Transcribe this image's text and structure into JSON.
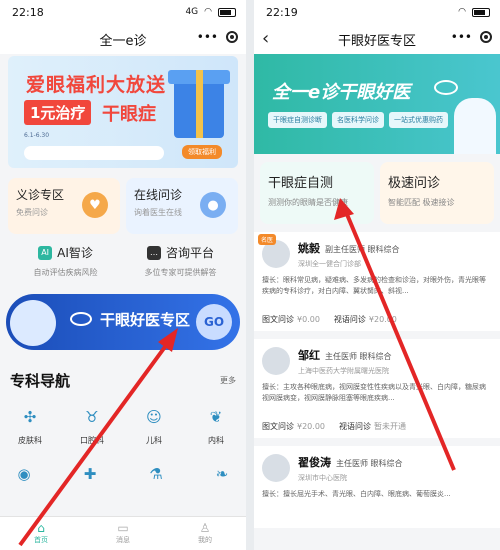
{
  "left": {
    "status": {
      "time": "22:18",
      "signal": "4G"
    },
    "nav_title": "全一e诊",
    "banner": {
      "line1": "爱眼福利大放送",
      "line2_tag": "1元治疗",
      "line2_text": "干眼症",
      "date": "6.1-6.30",
      "prize": "领取福利"
    },
    "cards": [
      {
        "title": "义诊专区",
        "sub": "免费问诊",
        "icon": "heart-icon"
      },
      {
        "title": "在线问诊",
        "sub": "询着医生在线",
        "icon": "mic-icon"
      }
    ],
    "row2": [
      {
        "title": "AI智诊",
        "sub": "自动评估疾病风险"
      },
      {
        "title": "咨询平台",
        "sub": "多位专家可提供解答"
      }
    ],
    "dry_eye_button": {
      "text": "干眼好医专区",
      "go": "GO"
    },
    "section": {
      "title": "专科导航",
      "more": "更多"
    },
    "depts": [
      {
        "label": "皮肤科",
        "icon": "skin-icon"
      },
      {
        "label": "口腔科",
        "icon": "tooth-icon"
      },
      {
        "label": "儿科",
        "icon": "baby-icon"
      },
      {
        "label": "内科",
        "icon": "stomach-icon"
      }
    ],
    "tabs": [
      {
        "label": "首页",
        "icon": "home-icon"
      },
      {
        "label": "消息",
        "icon": "message-icon"
      },
      {
        "label": "我的",
        "icon": "user-icon"
      }
    ]
  },
  "right": {
    "status": {
      "time": "22:19"
    },
    "nav_title": "干眼好医专区",
    "banner": {
      "title": "全一e诊干眼好医",
      "chips": [
        "干眼症自测诊断",
        "名医科学问诊",
        "一站式优惠购药"
      ]
    },
    "cards": [
      {
        "title": "干眼症自测",
        "sub": "测测你的眼睛是否健康"
      },
      {
        "title": "极速问诊",
        "sub": "智能匹配 极速接诊"
      }
    ],
    "doctors": [
      {
        "name": "姚毅",
        "title": "副主任医师 眼科综合",
        "hospital": "深圳全一健合门诊部",
        "badge": "名医",
        "spec": "擅长：眼科常见病，疑难病、多发病的检查和诊治，对眼外伤，青光眼等疾病的专科诊疗，对白内障、翼状胬肉、斜视...",
        "svc1": "图文问诊",
        "price1": "¥0.00",
        "svc2": "视语问诊",
        "price2": "¥20.00"
      },
      {
        "name": "邹红",
        "title": "主任医师 眼科综合",
        "hospital": "上海中医药大学附属曙光医院",
        "badge": "",
        "spec": "擅长：主攻各种眼底病，视网膜变性性疾病以及青光眼、白内障，糖尿病视网膜病变，视网膜静脉阻塞等眼底疾病...",
        "svc1": "图文问诊",
        "price1": "¥20.00",
        "svc2": "视语问诊",
        "price2": "暂未开通"
      },
      {
        "name": "翟俊涛",
        "title": "主任医师 眼科综合",
        "hospital": "深圳市中心医院",
        "badge": "",
        "spec": "擅长：擅长屈光手术、青光眼、白内障、眼底病、葡萄膜炎...",
        "svc1": "",
        "price1": "",
        "svc2": "",
        "price2": ""
      }
    ]
  },
  "colors": {
    "teal": "#2db7a0",
    "blue": "#3473e8",
    "arrow": "#e32626"
  }
}
